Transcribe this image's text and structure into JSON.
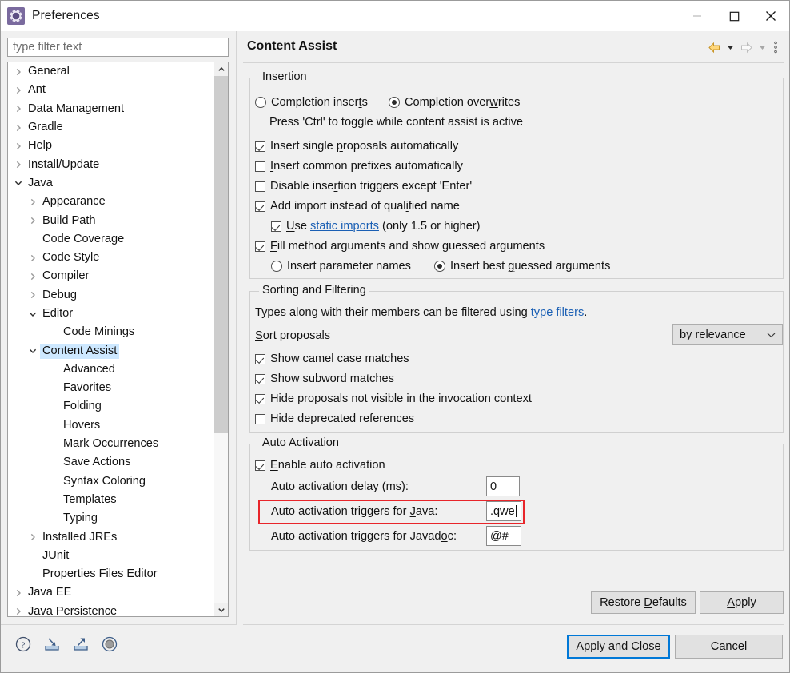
{
  "window": {
    "title": "Preferences",
    "icon": "gear-icon",
    "controls": {
      "minimize": "minimize-icon",
      "maximize": "maximize-icon",
      "close": "close-icon"
    }
  },
  "filter": {
    "placeholder": "type filter text",
    "value": ""
  },
  "tree": {
    "items": [
      {
        "label": "General",
        "indent": 1,
        "state": "collapsed",
        "selected": false
      },
      {
        "label": "Ant",
        "indent": 1,
        "state": "collapsed",
        "selected": false
      },
      {
        "label": "Data Management",
        "indent": 1,
        "state": "collapsed",
        "selected": false
      },
      {
        "label": "Gradle",
        "indent": 1,
        "state": "collapsed",
        "selected": false
      },
      {
        "label": "Help",
        "indent": 1,
        "state": "collapsed",
        "selected": false
      },
      {
        "label": "Install/Update",
        "indent": 1,
        "state": "collapsed",
        "selected": false
      },
      {
        "label": "Java",
        "indent": 1,
        "state": "expanded",
        "selected": false
      },
      {
        "label": "Appearance",
        "indent": 2,
        "state": "collapsed",
        "selected": false
      },
      {
        "label": "Build Path",
        "indent": 2,
        "state": "collapsed",
        "selected": false
      },
      {
        "label": "Code Coverage",
        "indent": 2,
        "state": "leaf",
        "selected": false
      },
      {
        "label": "Code Style",
        "indent": 2,
        "state": "collapsed",
        "selected": false
      },
      {
        "label": "Compiler",
        "indent": 2,
        "state": "collapsed",
        "selected": false
      },
      {
        "label": "Debug",
        "indent": 2,
        "state": "collapsed",
        "selected": false
      },
      {
        "label": "Editor",
        "indent": 2,
        "state": "expanded",
        "selected": false
      },
      {
        "label": "Code Minings",
        "indent": 3,
        "state": "leaf",
        "selected": false
      },
      {
        "label": "Content Assist",
        "indent": 2,
        "state": "expanded",
        "selected": true
      },
      {
        "label": "Advanced",
        "indent": 3,
        "state": "leaf",
        "selected": false
      },
      {
        "label": "Favorites",
        "indent": 3,
        "state": "leaf",
        "selected": false
      },
      {
        "label": "Folding",
        "indent": 3,
        "state": "leaf",
        "selected": false
      },
      {
        "label": "Hovers",
        "indent": 3,
        "state": "leaf",
        "selected": false
      },
      {
        "label": "Mark Occurrences",
        "indent": 3,
        "state": "leaf",
        "selected": false
      },
      {
        "label": "Save Actions",
        "indent": 3,
        "state": "leaf",
        "selected": false
      },
      {
        "label": "Syntax Coloring",
        "indent": 3,
        "state": "leaf",
        "selected": false
      },
      {
        "label": "Templates",
        "indent": 3,
        "state": "leaf",
        "selected": false
      },
      {
        "label": "Typing",
        "indent": 3,
        "state": "leaf",
        "selected": false
      },
      {
        "label": "Installed JREs",
        "indent": 2,
        "state": "collapsed",
        "selected": false
      },
      {
        "label": "JUnit",
        "indent": 2,
        "state": "leaf",
        "selected": false
      },
      {
        "label": "Properties Files Editor",
        "indent": 2,
        "state": "leaf",
        "selected": false
      },
      {
        "label": "Java EE",
        "indent": 1,
        "state": "collapsed",
        "selected": false
      },
      {
        "label": "Java Persistence",
        "indent": 1,
        "state": "collapsed",
        "selected": false
      }
    ],
    "scroll_up_icon": "chevron-up-icon",
    "scroll_down_icon": "chevron-down-icon"
  },
  "page": {
    "title": "Content Assist",
    "nav": {
      "back_icon": "back-arrow-icon",
      "back_caret_icon": "caret-down-icon",
      "forward_icon": "forward-arrow-icon",
      "forward_caret_icon": "caret-down-icon",
      "menu_icon": "vertical-dots-icon"
    }
  },
  "insertion": {
    "group_label": "Insertion",
    "radio_inserts": {
      "label": "Completion inserts",
      "mnemonic": "t",
      "checked": false
    },
    "radio_overwrites": {
      "label": "Completion overwrites",
      "mnemonic": "w",
      "checked": true
    },
    "hint": "Press 'Ctrl' to toggle while content assist is active",
    "cb_single": {
      "label": "Insert single proposals automatically",
      "mnemonic": "p",
      "checked": true
    },
    "cb_prefixes": {
      "label": "Insert common prefixes automatically",
      "mnemonic": "I",
      "checked": false
    },
    "cb_disable": {
      "label": "Disable insertion triggers except 'Enter'",
      "mnemonic": "r",
      "checked": false
    },
    "cb_addimport": {
      "label": "Add import instead of qualified name",
      "mnemonic": "i",
      "checked": true
    },
    "cb_static": {
      "prefix": "Use ",
      "mnemonic": "U",
      "link": "static imports",
      "suffix": " (only 1.5 or higher)",
      "checked": true
    },
    "cb_fill": {
      "label": "Fill method arguments and show guessed arguments",
      "mnemonic": "F",
      "checked": true
    },
    "radio_paramnames": {
      "label": "Insert parameter names",
      "mnemonic": "n",
      "checked": false
    },
    "radio_guessed": {
      "label": "Insert best guessed arguments",
      "mnemonic": "g",
      "checked": true
    }
  },
  "sorting": {
    "group_label": "Sorting and Filtering",
    "description_prefix": "Types along with their members can be filtered using ",
    "description_link": "type filters",
    "description_suffix": ".",
    "sort_label": "Sort proposals",
    "sort_mnemonic": "S",
    "sort_value": "by relevance",
    "sort_options": [
      "by relevance"
    ],
    "cb_camel": {
      "label": "Show camel case matches",
      "mnemonic": "m",
      "checked": true
    },
    "cb_subword": {
      "label": "Show subword matches",
      "mnemonic": "c",
      "checked": true
    },
    "cb_hideinvisible": {
      "label": "Hide proposals not visible in the invocation context",
      "mnemonic": "v",
      "checked": true
    },
    "cb_hidedeprecated": {
      "label": "Hide deprecated references",
      "mnemonic": "H",
      "checked": false
    }
  },
  "auto_activation": {
    "group_label": "Auto Activation",
    "cb_enable": {
      "label": "Enable auto activation",
      "mnemonic": "E",
      "checked": true
    },
    "delay_label": "Auto activation delay (ms):",
    "delay_mnemonic": "y",
    "delay_value": "0",
    "java_label": "Auto activation triggers for Java:",
    "java_mnemonic": "J",
    "java_value": ".qwe",
    "java_focused": true,
    "javadoc_label": "Auto activation triggers for Javadoc:",
    "javadoc_mnemonic": "o",
    "javadoc_value": "@#",
    "highlight_color": "#e8252a"
  },
  "buttons": {
    "restore_defaults": "Restore Defaults",
    "restore_mnemonic": "D",
    "apply": "Apply",
    "apply_mnemonic": "A",
    "apply_and_close": "Apply and Close",
    "cancel": "Cancel",
    "focus_color": "#0078d7"
  },
  "bottom_icons": [
    {
      "name": "help-icon"
    },
    {
      "name": "import-icon"
    },
    {
      "name": "export-icon"
    },
    {
      "name": "sphere-icon"
    }
  ]
}
